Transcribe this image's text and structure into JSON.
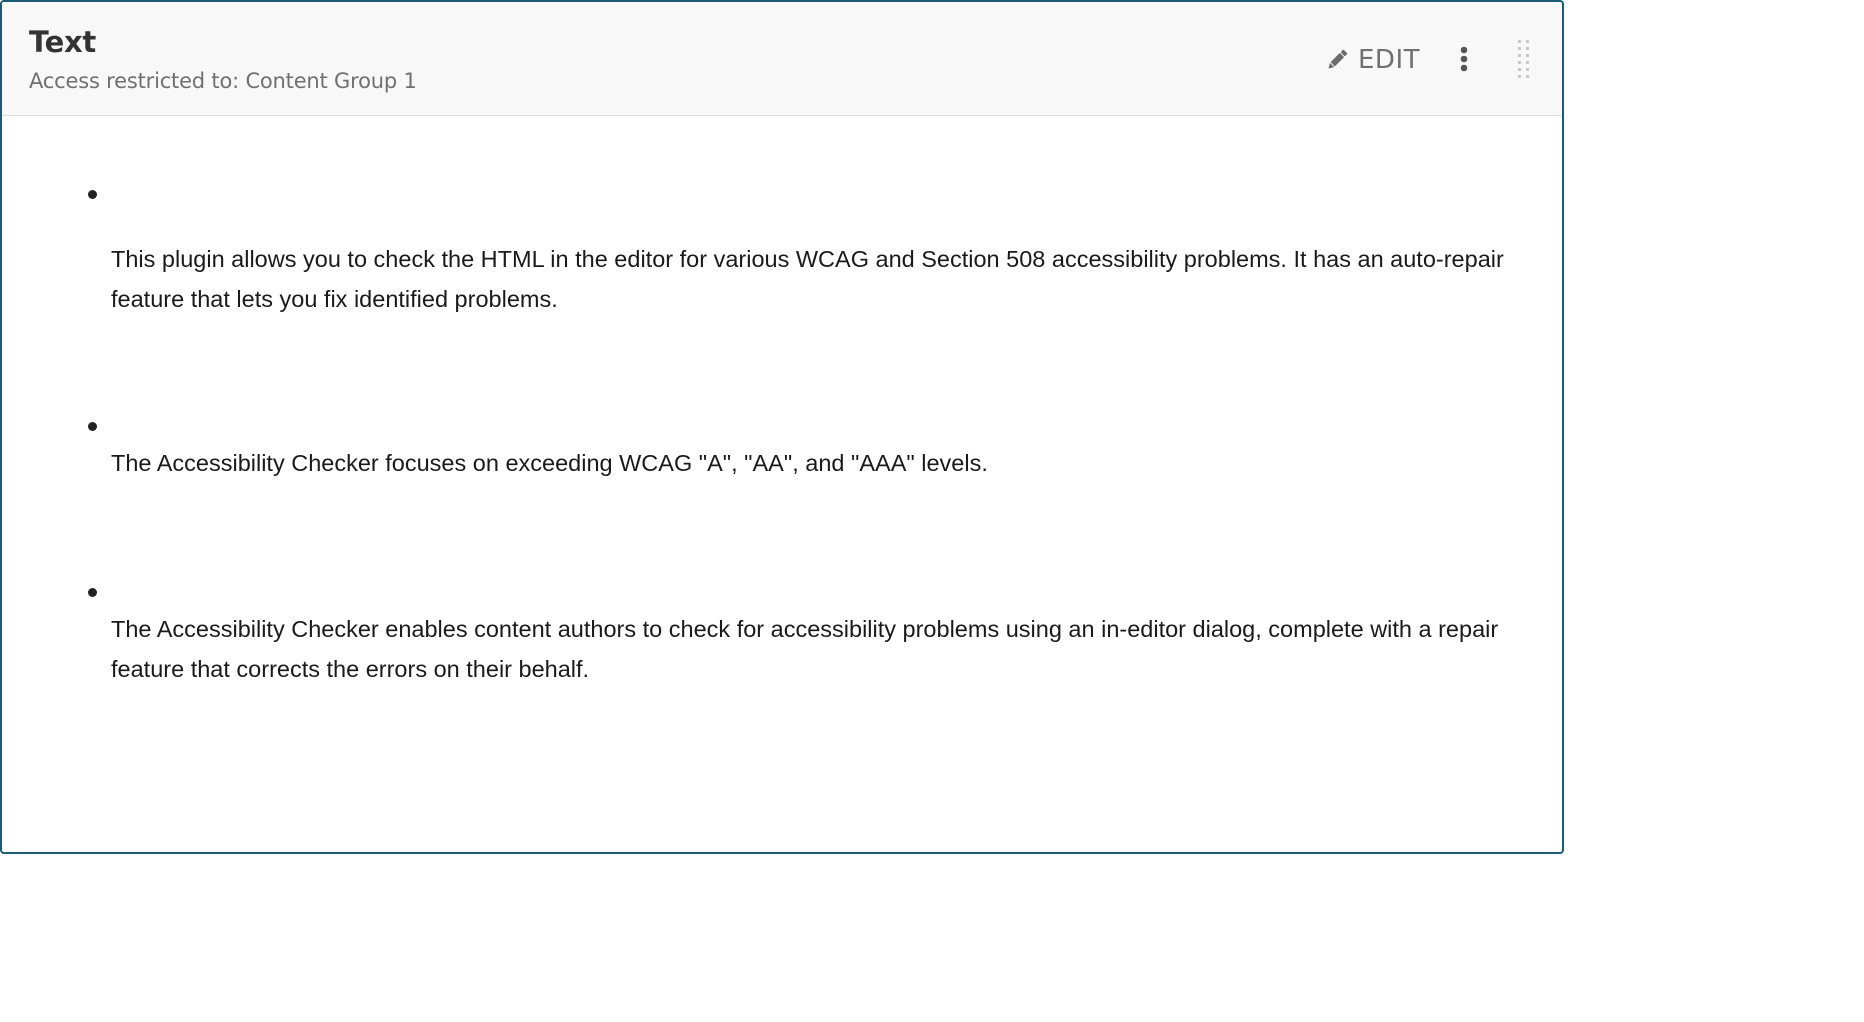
{
  "component": {
    "title": "Text",
    "subtitle": "Access restricted to: Content Group 1",
    "edit_label": "EDIT"
  },
  "content": {
    "items": [
      {
        "text": "This plugin allows you to check the HTML in the editor for various WCAG and Section 508 accessibility problems. It has an auto-repair feature that lets you fix identified problems."
      },
      {
        "text": "The Accessibility Checker focuses on exceeding WCAG \"A\", \"AA\", and \"AAA\" levels."
      },
      {
        "text": "The Accessibility Checker enables content authors to check for accessibility problems using an in-editor dialog, complete with a repair feature that corrects the errors on their behalf."
      }
    ]
  },
  "icons": {
    "edit": "pencil-icon",
    "menu": "vertical-ellipsis-icon",
    "drag": "drag-handle-icon"
  },
  "colors": {
    "border": "#1f5a73",
    "header_bg": "#f8f8f8",
    "title": "#333333",
    "subtitle": "#707070"
  }
}
